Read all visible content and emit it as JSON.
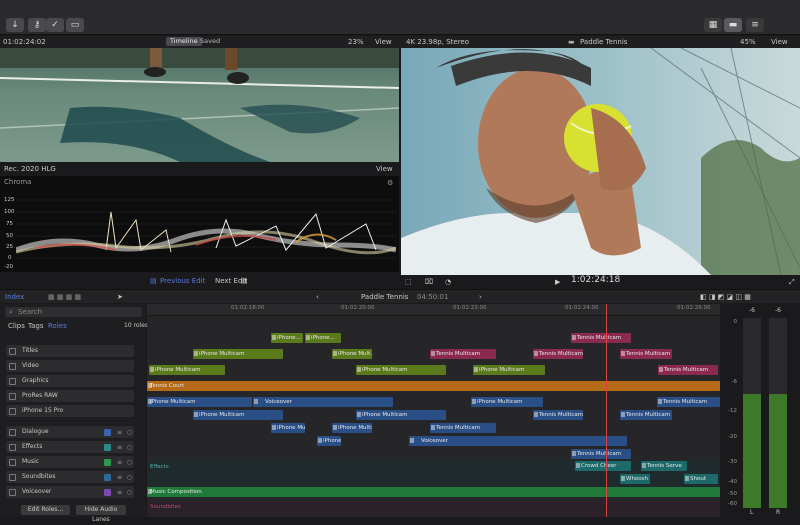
{
  "timecode_top": "01:02:24:02",
  "viewer_left": {
    "toggle": [
      "Timeline",
      "Saved"
    ],
    "zoom": "23%",
    "view": "View"
  },
  "viewer_right": {
    "format": "4K 23.98p, Stereo",
    "title": "Paddle Tennis",
    "zoom": "45%",
    "view": "View",
    "timecode": "1:02:24:18"
  },
  "scope": {
    "colorspace": "Rec. 2020 HLG",
    "view": "View",
    "label": "Chroma",
    "axis": [
      "125",
      "100",
      "75",
      "50",
      "25",
      "0",
      "-20"
    ]
  },
  "nav": {
    "prev": "Previous Edit",
    "next": "Next Edit"
  },
  "timeline_bar": {
    "index": "Index",
    "project": "Paddle Tennis",
    "duration": "04:50:01"
  },
  "sidebar": {
    "search_placeholder": "Search",
    "tabs": [
      "Clips",
      "Tags",
      "Roles"
    ],
    "count": "10 roles",
    "video_roles": [
      "Titles",
      "Video",
      "Graphics",
      "ProRes RAW",
      "iPhone 15 Pro"
    ],
    "audio_roles": [
      {
        "name": "Dialogue",
        "color": "#3a64b0"
      },
      {
        "name": "Effects",
        "color": "#2a8a8a"
      },
      {
        "name": "Music",
        "color": "#2a9a4a"
      },
      {
        "name": "Soundbites",
        "color": "#2a6a9a"
      },
      {
        "name": "Voiceover",
        "color": "#7a4ab0"
      }
    ],
    "edit_roles": "Edit Roles...",
    "hide_lanes": "Hide Audio Lanes"
  },
  "ruler": [
    "01:02:18:00",
    "01:02:20:00",
    "01:02:22:00",
    "01:02:24:00",
    "01:02:26:00"
  ],
  "clips": {
    "c1": "iPhone...",
    "c2": "iPhone...",
    "c3": "Tennis Multicam",
    "c4": "iPhone Multicam",
    "c5": "iPhone Mult...",
    "c6": "Tennis Multicam",
    "c7": "Tennis Multicam",
    "c8": "Tennis Multicam",
    "c9": "iPhone Multicam",
    "c10": "iPhone Multicam",
    "c11": "iPhone Multicam",
    "c12": "Tennis Multicam",
    "c13": "Tennis Court",
    "c14": "iPhone Multicam",
    "c15": "Voiceover",
    "c16": "iPhone Multicam",
    "c17": "Tennis Multicam",
    "c18": "iPhone Multicam",
    "c19": "iPhone Multicam",
    "c20": "Tennis Multicam",
    "c21": "Tennis Multicam",
    "c22": "iPhone Mult...",
    "c23": "iPhone Multicam",
    "c24": "Tennis Multicam",
    "c25": "iPhone...",
    "c26": "Voiceover",
    "c27": "Tennis Multicam",
    "c28": "Effects",
    "c29": "Crowd Cheer",
    "c30": "Tennis Serve",
    "c31": "Whoosh",
    "c32": "Shout",
    "c33": "Music Composition",
    "c34": "Soundbites"
  },
  "meters": {
    "peak_left": "-6",
    "peak_right": "-6",
    "scale": [
      "0",
      "-6",
      "-12",
      "-20",
      "-30",
      "-40",
      "-50",
      "-60"
    ],
    "channels": [
      "L",
      "R"
    ],
    "level_left": 0.6,
    "level_right": 0.6
  }
}
